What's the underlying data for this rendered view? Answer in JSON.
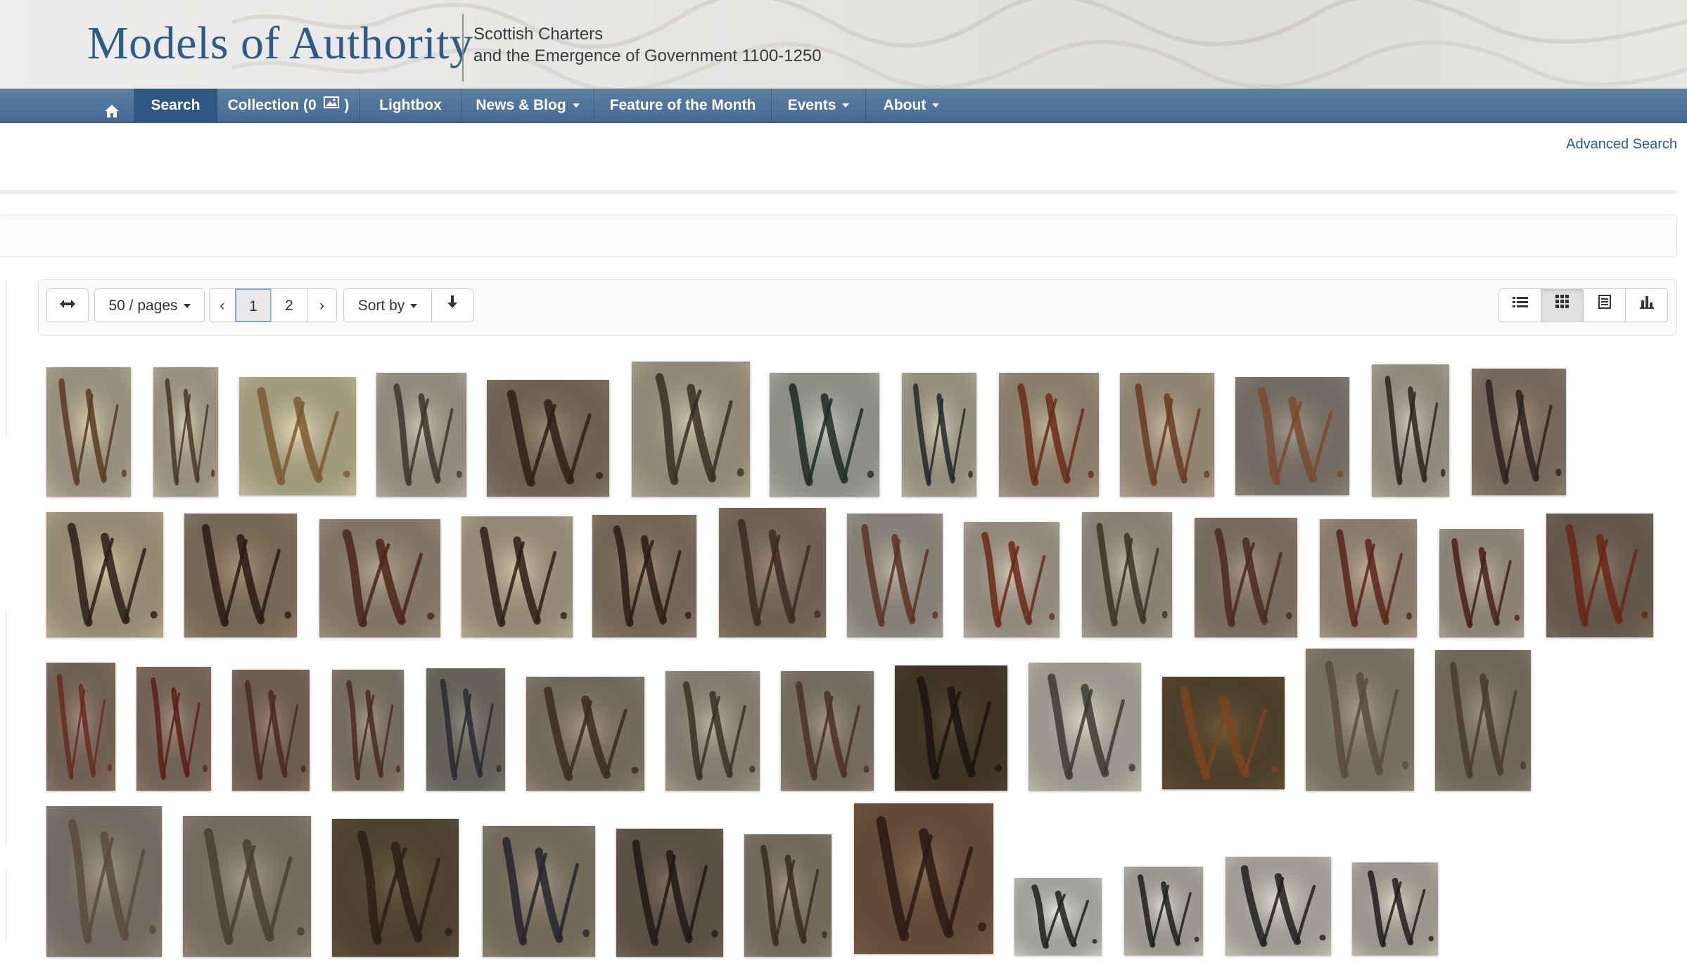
{
  "header": {
    "site_title": "Models of Authority",
    "tagline_line1": "Scottish Charters",
    "tagline_line2": "and the Emergence of Government 1100-1250"
  },
  "nav": {
    "home_icon": "home-icon",
    "items": [
      {
        "label": "Search",
        "active": true
      },
      {
        "label": "Collection (0",
        "suffix": ")",
        "icon": "image-icon"
      },
      {
        "label": "Lightbox"
      },
      {
        "label": "News & Blog",
        "dropdown": true
      },
      {
        "label": "Feature of the Month"
      },
      {
        "label": "Events",
        "dropdown": true
      },
      {
        "label": "About",
        "dropdown": true
      }
    ]
  },
  "advanced_search": "Advanced Search",
  "toolbar": {
    "expand_icon": "expand-horizontal-icon",
    "page_size": "50 / pages",
    "prev": "‹",
    "pages": [
      "1",
      "2"
    ],
    "current_page": "1",
    "next": "›",
    "sort_by": "Sort by",
    "sort_direction_icon": "arrow-down-icon",
    "view_modes": [
      "list-view-icon",
      "grid-view-icon",
      "detail-view-icon",
      "chart-view-icon"
    ],
    "active_view": "grid-view-icon"
  },
  "results": {
    "count_shown": 50,
    "letter": "W"
  },
  "colors": {
    "brand_blue": "#2e5c8a",
    "nav_bar": "#4f7399",
    "nav_active": "#2f5782",
    "active_page_border": "#7da5cf"
  }
}
